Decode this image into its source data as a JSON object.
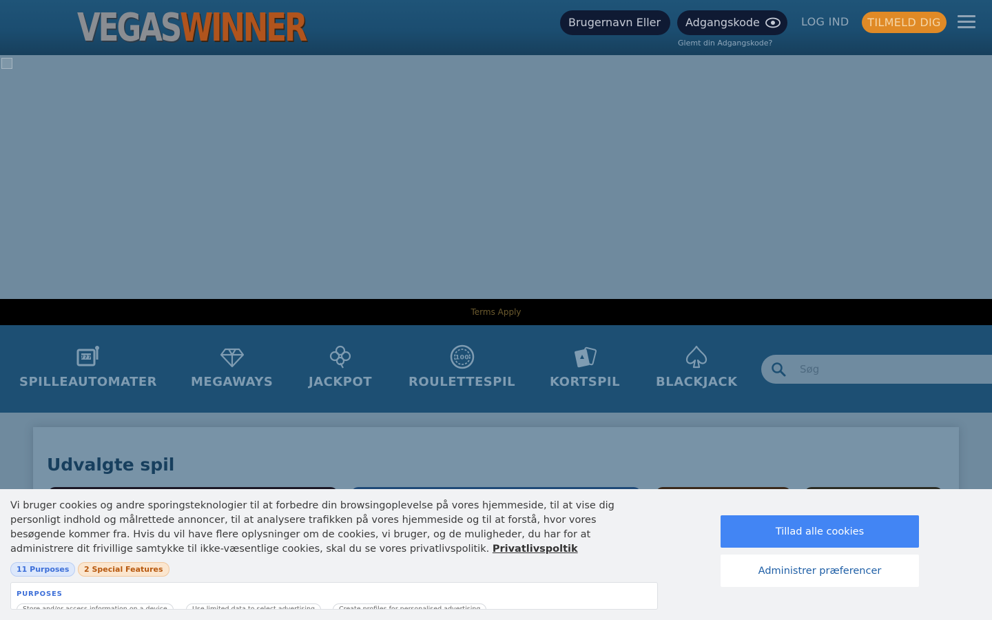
{
  "header": {
    "logo_part1": "VEGAS",
    "logo_part2": "WINNER",
    "username_placeholder": "Brugernavn Eller",
    "password_placeholder": "Adgangskode",
    "forgot_link": "Glemt din Adgangskode?",
    "login_label": "LOG IND",
    "signup_label": "TILMELD DIG"
  },
  "banner": {
    "terms": "Terms Apply"
  },
  "categories": [
    {
      "label": "SPILLEAUTOMATER",
      "icon": "slot-machine-icon"
    },
    {
      "label": "MEGAWAYS",
      "icon": "diamond-icon"
    },
    {
      "label": "JACKPOT",
      "icon": "clover-icon"
    },
    {
      "label": "ROULETTESPIL",
      "icon": "chip-icon"
    },
    {
      "label": "KORTSPIL",
      "icon": "cards-icon"
    },
    {
      "label": "BLACKJACK",
      "icon": "spade-icon"
    }
  ],
  "search": {
    "placeholder": "Søg"
  },
  "featured": {
    "title": "Udvalgte spil"
  },
  "cookie": {
    "text": "Vi bruger cookies og andre sporingsteknologier til at forbedre din browsingoplevelse på vores hjemmeside, til at vise dig personligt indhold og målrettede annoncer, til at analysere trafikken på vores hjemmeside og til at forstå, hvor vores besøgende kommer fra. Hvis du vil have flere oplysninger om de cookies, vi bruger, og de muligheder, du har for at administrere dit frivillige samtykke til ikke-væsentlige cookies, skal du se vores privatlivspolitik.",
    "privacy_link": "Privatlivspoltik",
    "purposes_badge": "11 Purposes",
    "features_badge": "2 Special Features",
    "purposes_heading": "PURPOSES",
    "purpose_tags": [
      "Store and/or access information on a device",
      "Use limited data to select advertising",
      "Create profiles for personalised advertising"
    ],
    "allow_all": "Tillad alle cookies",
    "manage": "Administrer præferencer"
  }
}
